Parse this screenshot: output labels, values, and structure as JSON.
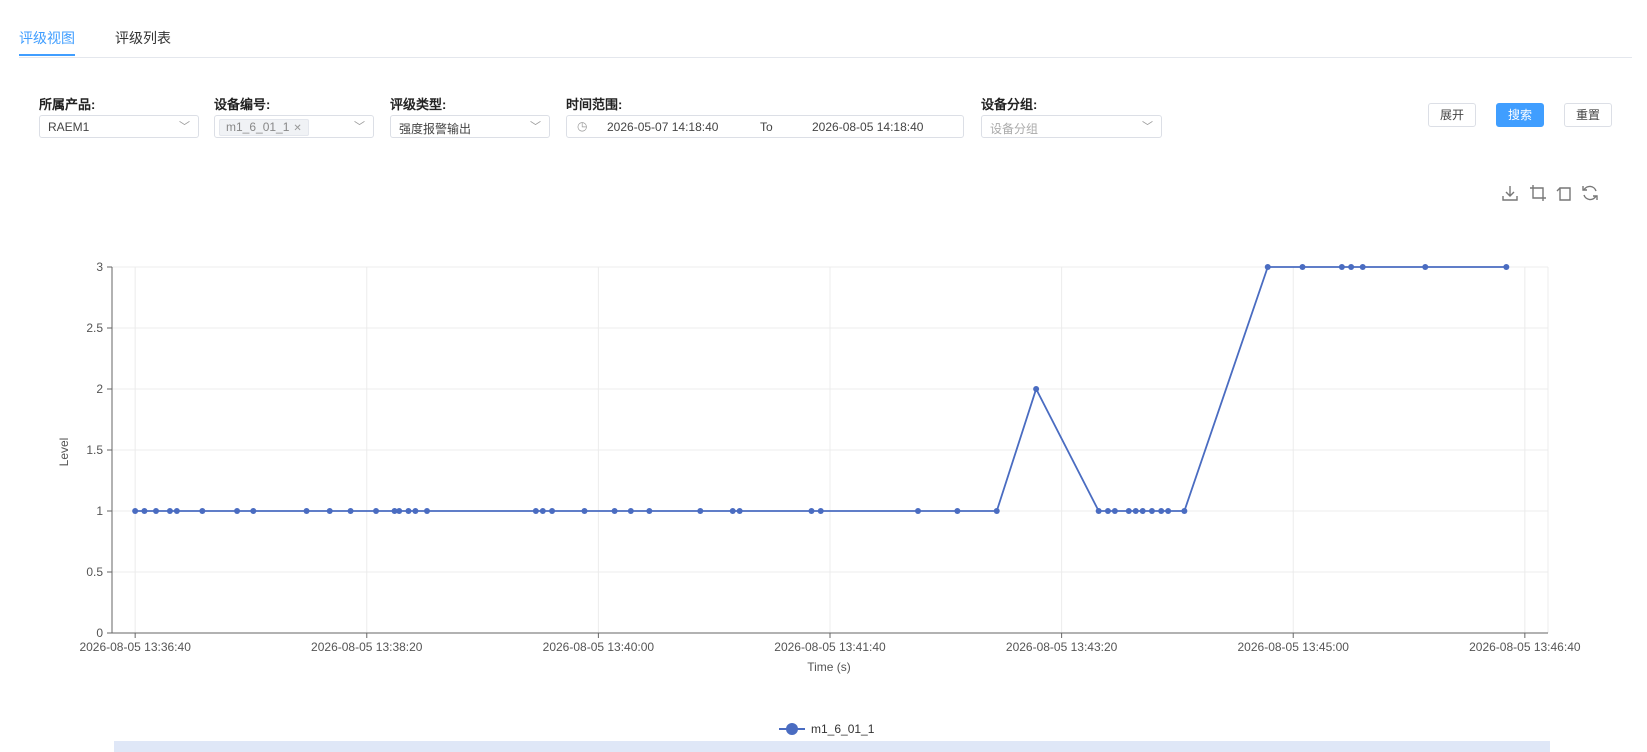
{
  "tabs": [
    {
      "label": "评级视图",
      "active": true
    },
    {
      "label": "评级列表",
      "active": false
    }
  ],
  "filters": {
    "product": {
      "label": "所属产品:",
      "value": "RAEM1"
    },
    "device": {
      "label": "设备编号:",
      "tag": "m1_6_01_1"
    },
    "rating_type": {
      "label": "评级类型:",
      "value": "强度报警输出"
    },
    "time_range": {
      "label": "时间范围:",
      "start": "2026-05-07 14:18:40",
      "separator": "To",
      "end": "2026-08-05 14:18:40"
    },
    "device_group": {
      "label": "设备分组:",
      "placeholder": "设备分组"
    }
  },
  "buttons": {
    "expand": "展开",
    "search": "搜索",
    "reset": "重置"
  },
  "colors": {
    "accent": "#409eff",
    "series": "#4a6cc1"
  },
  "toolbox_icons": [
    "download-icon",
    "zoom-select-icon",
    "zoom-reset-icon",
    "restore-icon"
  ],
  "chart_data": {
    "type": "line",
    "xlabel": "Time (s)",
    "ylabel": "Level",
    "ylim": [
      0,
      3
    ],
    "yticks": [
      0,
      0.5,
      1,
      1.5,
      2,
      2.5,
      3
    ],
    "xlim": [
      "2026-08-05 13:36:30",
      "2026-08-05 13:46:50"
    ],
    "xticks": [
      "2026-08-05 13:36:40",
      "2026-08-05 13:38:20",
      "2026-08-05 13:40:00",
      "2026-08-05 13:41:40",
      "2026-08-05 13:43:20",
      "2026-08-05 13:45:00",
      "2026-08-05 13:46:40"
    ],
    "grid": true,
    "legend": "bottom-center",
    "series": [
      {
        "name": "m1_6_01_1",
        "points": [
          [
            "2026-08-05 13:36:40",
            1
          ],
          [
            "2026-08-05 13:36:44",
            1
          ],
          [
            "2026-08-05 13:36:49",
            1
          ],
          [
            "2026-08-05 13:36:55",
            1
          ],
          [
            "2026-08-05 13:36:58",
            1
          ],
          [
            "2026-08-05 13:37:09",
            1
          ],
          [
            "2026-08-05 13:37:24",
            1
          ],
          [
            "2026-08-05 13:37:31",
            1
          ],
          [
            "2026-08-05 13:37:54",
            1
          ],
          [
            "2026-08-05 13:38:04",
            1
          ],
          [
            "2026-08-05 13:38:13",
            1
          ],
          [
            "2026-08-05 13:38:24",
            1
          ],
          [
            "2026-08-05 13:38:32",
            1
          ],
          [
            "2026-08-05 13:38:34",
            1
          ],
          [
            "2026-08-05 13:38:38",
            1
          ],
          [
            "2026-08-05 13:38:41",
            1
          ],
          [
            "2026-08-05 13:38:46",
            1
          ],
          [
            "2026-08-05 13:39:33",
            1
          ],
          [
            "2026-08-05 13:39:36",
            1
          ],
          [
            "2026-08-05 13:39:40",
            1
          ],
          [
            "2026-08-05 13:39:54",
            1
          ],
          [
            "2026-08-05 13:40:07",
            1
          ],
          [
            "2026-08-05 13:40:14",
            1
          ],
          [
            "2026-08-05 13:40:22",
            1
          ],
          [
            "2026-08-05 13:40:44",
            1
          ],
          [
            "2026-08-05 13:40:58",
            1
          ],
          [
            "2026-08-05 13:41:01",
            1
          ],
          [
            "2026-08-05 13:41:32",
            1
          ],
          [
            "2026-08-05 13:41:36",
            1
          ],
          [
            "2026-08-05 13:42:18",
            1
          ],
          [
            "2026-08-05 13:42:35",
            1
          ],
          [
            "2026-08-05 13:42:52",
            1
          ],
          [
            "2026-08-05 13:43:09",
            2
          ],
          [
            "2026-08-05 13:43:36",
            1
          ],
          [
            "2026-08-05 13:43:40",
            1
          ],
          [
            "2026-08-05 13:43:43",
            1
          ],
          [
            "2026-08-05 13:43:49",
            1
          ],
          [
            "2026-08-05 13:43:52",
            1
          ],
          [
            "2026-08-05 13:43:55",
            1
          ],
          [
            "2026-08-05 13:43:59",
            1
          ],
          [
            "2026-08-05 13:44:03",
            1
          ],
          [
            "2026-08-05 13:44:06",
            1
          ],
          [
            "2026-08-05 13:44:13",
            1
          ],
          [
            "2026-08-05 13:44:49",
            3
          ],
          [
            "2026-08-05 13:45:04",
            3
          ],
          [
            "2026-08-05 13:45:21",
            3
          ],
          [
            "2026-08-05 13:45:25",
            3
          ],
          [
            "2026-08-05 13:45:30",
            3
          ],
          [
            "2026-08-05 13:45:57",
            3
          ],
          [
            "2026-08-05 13:46:32",
            3
          ]
        ]
      }
    ]
  }
}
